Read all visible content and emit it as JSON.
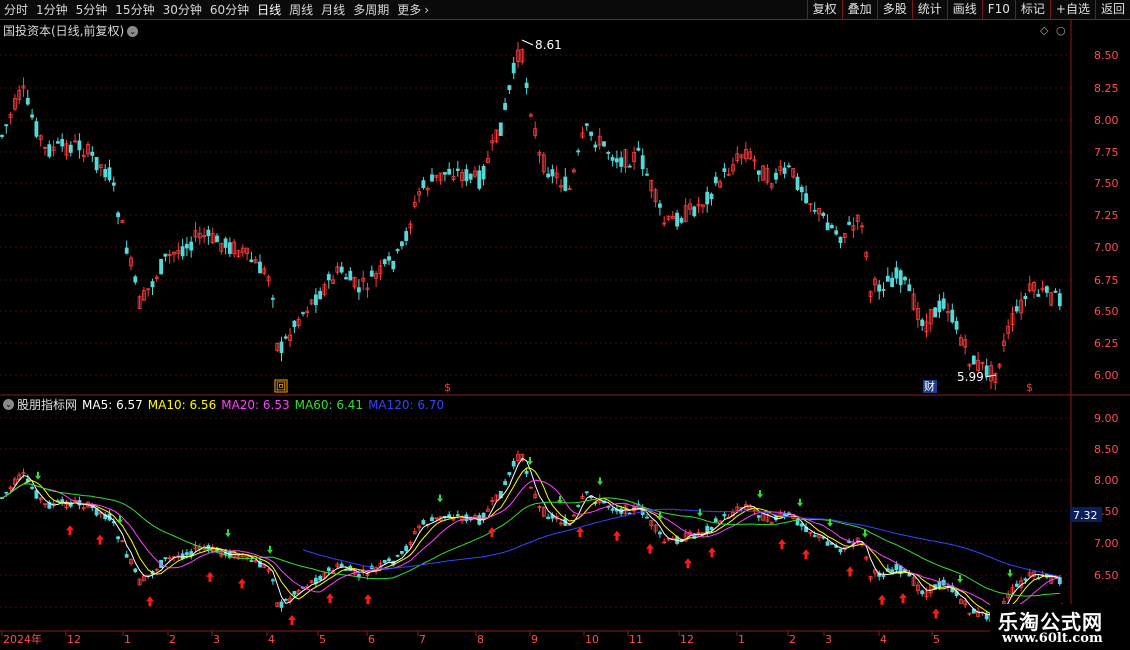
{
  "toolbar": {
    "periods": [
      "分时",
      "1分钟",
      "5分钟",
      "15分钟",
      "30分钟",
      "60分钟",
      "日线",
      "周线",
      "月线",
      "多周期",
      "更多"
    ],
    "active_period": "日线",
    "actions": [
      "复权",
      "叠加",
      "多股",
      "统计",
      "画线",
      "F10",
      "标记",
      "+自选",
      "返回"
    ]
  },
  "price_pane": {
    "title": "国投资本(日线,前复权)",
    "high_label": "8.61",
    "low_label": "5.99",
    "y_ticks": [
      "8.50",
      "8.25",
      "8.00",
      "7.75",
      "7.50",
      "7.25",
      "7.00",
      "6.75",
      "6.50",
      "6.25",
      "6.00"
    ],
    "markers": [
      "回",
      "$",
      "财",
      "$"
    ]
  },
  "indicator_pane": {
    "name": "股朋指标网",
    "ma_labels": [
      {
        "text": "MA5: 6.57",
        "color": "#ffffff"
      },
      {
        "text": "MA10: 6.56",
        "color": "#ffff00"
      },
      {
        "text": "MA20: 6.53",
        "color": "#ff40ff"
      },
      {
        "text": "MA60: 6.41",
        "color": "#33dd33"
      },
      {
        "text": "MA120: 6.70",
        "color": "#3344ff"
      }
    ],
    "y_ticks": [
      "9.00",
      "8.50",
      "8.00",
      "7.50",
      "7.00",
      "6.50"
    ],
    "price_tag": "7.32"
  },
  "time_axis": {
    "labels": [
      "2024年",
      "12",
      "1",
      "2",
      "3",
      "4",
      "5",
      "6",
      "7",
      "8",
      "9",
      "10",
      "11",
      "12",
      "1",
      "2",
      "3",
      "4",
      "5"
    ]
  },
  "watermark": {
    "title": "乐淘公式网",
    "site": "www.60lt.com"
  },
  "colors": {
    "up": "#ff3c3c",
    "down": "#55d8d8",
    "grid": "#8b1a1a",
    "axis_text": "#ff4d4d"
  },
  "icons": [
    "chevron-right-icon",
    "chevron-down-circle-icon",
    "diamond-icon",
    "pane-close-icon"
  ]
}
